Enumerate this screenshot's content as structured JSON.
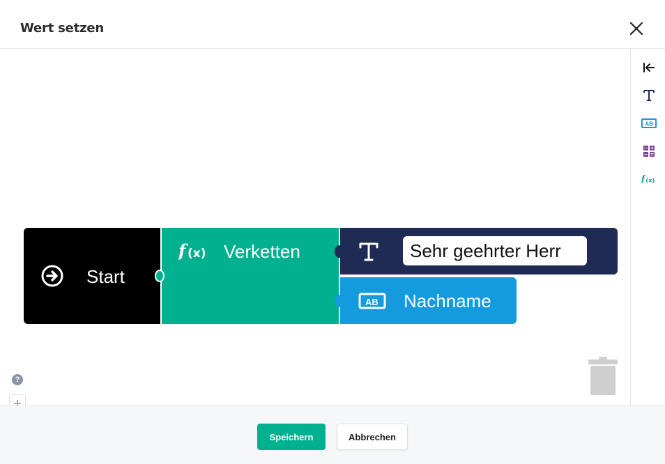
{
  "dialog": {
    "title": "Wert setzen"
  },
  "toolbox": {
    "items": [
      {
        "icon": "collapse-left-icon"
      },
      {
        "icon": "text-icon"
      },
      {
        "icon": "variable-ab-icon"
      },
      {
        "icon": "calculator-icon"
      },
      {
        "icon": "function-icon"
      }
    ]
  },
  "blocks": {
    "start": {
      "label": "Start",
      "icon": "arrow-circle-right-icon"
    },
    "concat": {
      "label": "Verketten",
      "icon": "function-icon"
    },
    "text": {
      "value": "Sehr geehrter Herr",
      "icon": "text-icon"
    },
    "variable": {
      "label": "Nachname",
      "icon": "variable-ab-icon"
    }
  },
  "zoom": {
    "help": "?"
  },
  "footer": {
    "save_label": "Speichern",
    "cancel_label": "Abbrechen"
  },
  "colors": {
    "accent": "#00b08f",
    "start_block": "#000000",
    "text_block": "#1f2a55",
    "variable_block": "#149bdd",
    "calc_icon": "#7b3f98"
  }
}
